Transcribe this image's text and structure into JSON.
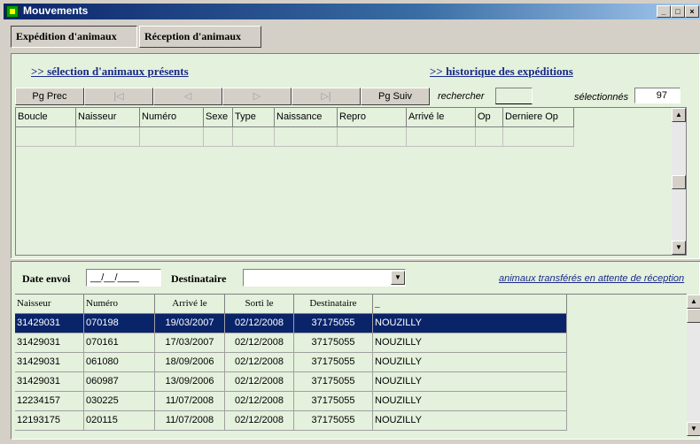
{
  "window": {
    "title": "Mouvements"
  },
  "tabs": [
    {
      "label": "Expédition d'animaux"
    },
    {
      "label": "Réception d'animaux"
    }
  ],
  "links": {
    "selection": ">> sélection d'animaux présents",
    "historique": ">> historique des expéditions"
  },
  "nav": {
    "prev": "Pg Prec",
    "first": "|◁",
    "back": "◁",
    "fwd": "▷",
    "last": "▷|",
    "next": "Pg Suiv",
    "rechercher_label": "rechercher",
    "rechercher_value": "",
    "selectionnes_label": "sélectionnés",
    "selectionnes_value": "97"
  },
  "grid1": {
    "headers": [
      "Boucle",
      "Naisseur",
      "Numéro",
      "Sexe",
      "Type",
      "Naissance",
      "Repro",
      "Arrivé le",
      "Op",
      "Derniere Op"
    ]
  },
  "envoi": {
    "date_label": "Date envoi",
    "date_value": "__/__/____",
    "destinataire_label": "Destinataire",
    "destinataire_value": "",
    "attente_link": "animaux transférés en attente de réception"
  },
  "grid2": {
    "headers": [
      "Naisseur",
      "Numéro",
      "Arrivé le",
      "Sorti le",
      "Destinataire",
      "_"
    ],
    "rows": [
      [
        "31429031",
        "070198",
        "19/03/2007",
        "02/12/2008",
        "37175055",
        "NOUZILLY"
      ],
      [
        "31429031",
        "070161",
        "17/03/2007",
        "02/12/2008",
        "37175055",
        "NOUZILLY"
      ],
      [
        "31429031",
        "061080",
        "18/09/2006",
        "02/12/2008",
        "37175055",
        "NOUZILLY"
      ],
      [
        "31429031",
        "060987",
        "13/09/2006",
        "02/12/2008",
        "37175055",
        "NOUZILLY"
      ],
      [
        "12234157",
        "030225",
        "11/07/2008",
        "02/12/2008",
        "37175055",
        "NOUZILLY"
      ],
      [
        "12193175",
        "020115",
        "11/07/2008",
        "02/12/2008",
        "37175055",
        "NOUZILLY"
      ]
    ],
    "selected_row": 0
  },
  "colors": {
    "selection": "#0a246a",
    "panel": "#e4f1dc",
    "link": "#1a2a8a"
  }
}
